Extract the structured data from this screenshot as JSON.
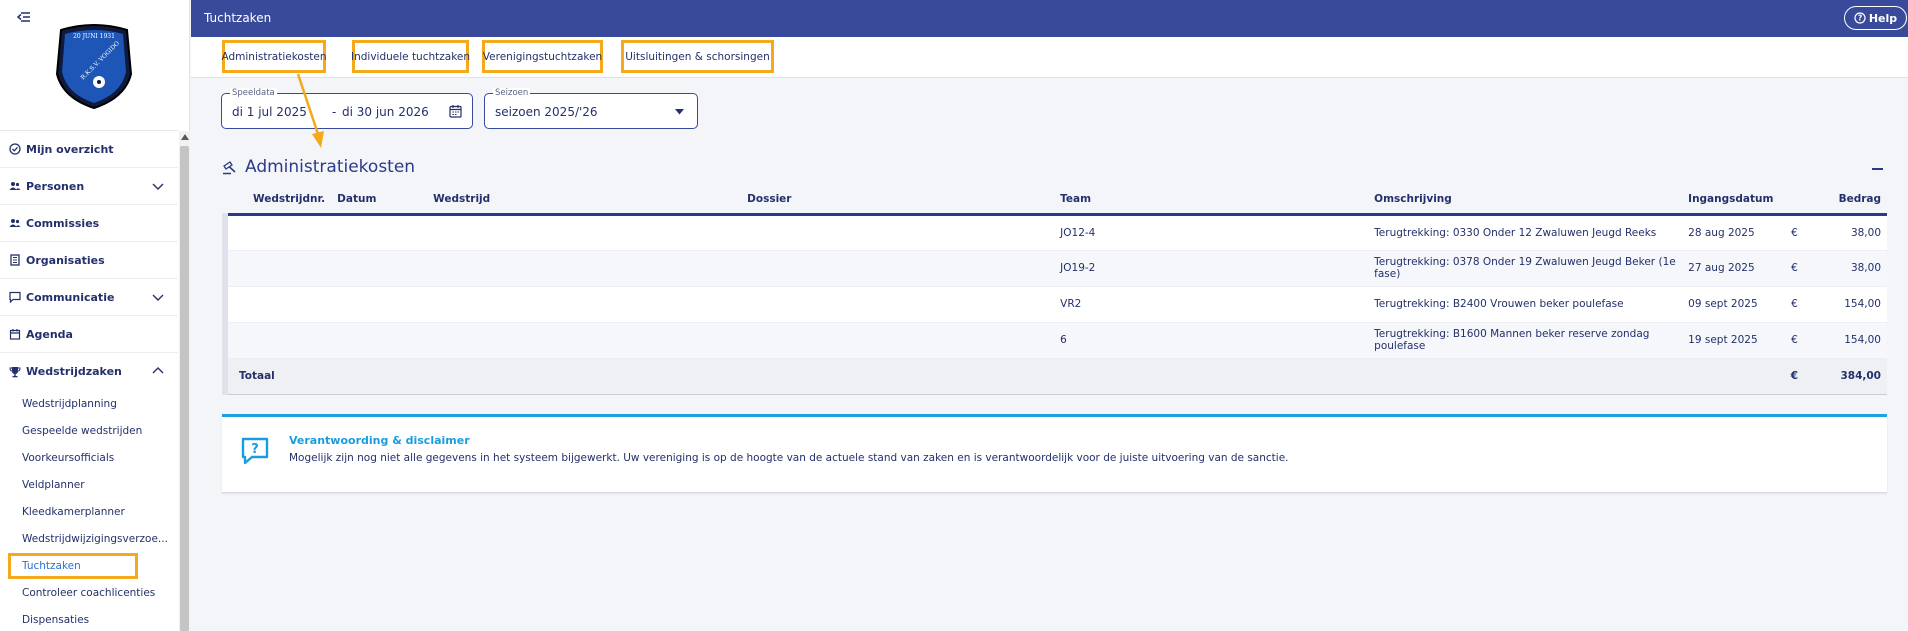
{
  "sidebar": {
    "logo_text": "R.K.S.V. VOGIDO 20 JUNI 1931",
    "items": [
      {
        "label": "Mijn overzicht",
        "icon": "check-circle-icon"
      },
      {
        "label": "Personen",
        "icon": "users-icon",
        "expandable": true
      },
      {
        "label": "Commissies",
        "icon": "users-icon"
      },
      {
        "label": "Organisaties",
        "icon": "building-icon"
      },
      {
        "label": "Communicatie",
        "icon": "chat-icon",
        "expandable": true
      },
      {
        "label": "Agenda",
        "icon": "calendar-icon"
      },
      {
        "label": "Wedstrijdzaken",
        "icon": "trophy-icon",
        "expanded": true
      }
    ],
    "subitems": [
      "Wedstrijdplanning",
      "Gespeelde wedstrijden",
      "Voorkeursofficials",
      "Veldplanner",
      "Kleedkamerplanner",
      "Wedstrijdwijzigingsverzoe...",
      "Tuchtzaken",
      "Controleer coachlicenties",
      "Dispensaties"
    ]
  },
  "header": {
    "title": "Tuchtzaken",
    "help_label": "Help"
  },
  "tabs": [
    {
      "label": "Administratiekosten",
      "active": true
    },
    {
      "label": "Individuele tuchtzaken"
    },
    {
      "label": "Verenigingstuchtzaken"
    },
    {
      "label": "Uitsluitingen & schorsingen"
    }
  ],
  "filters": {
    "date_legend": "Speeldata",
    "date_from": "di 1 jul 2025",
    "date_sep": "-",
    "date_to": "di 30 jun 2026",
    "season_legend": "Seizoen",
    "season_value": "seizoen 2025/'26"
  },
  "panel": {
    "title": "Administratiekosten",
    "columns": [
      "Wedstrijdnr.",
      "Datum",
      "Wedstrijd",
      "Dossier",
      "Team",
      "Omschrijving",
      "Ingangsdatum",
      "Bedrag"
    ],
    "rows": [
      {
        "team": "JO12-4",
        "omschrijving": "Terugtrekking: 0330 Onder 12 Zwaluwen Jeugd Reeks",
        "ingangsdatum": "28 aug 2025",
        "currency": "€",
        "bedrag": "38,00"
      },
      {
        "team": "JO19-2",
        "omschrijving": "Terugtrekking: 0378 Onder 19 Zwaluwen Jeugd Beker (1e fase)",
        "ingangsdatum": "27 aug 2025",
        "currency": "€",
        "bedrag": "38,00"
      },
      {
        "team": "VR2",
        "omschrijving": "Terugtrekking: B2400 Vrouwen beker poulefase",
        "ingangsdatum": "09 sept 2025",
        "currency": "€",
        "bedrag": "154,00"
      },
      {
        "team": "6",
        "omschrijving": "Terugtrekking: B1600 Mannen beker reserve zondag poulefase",
        "ingangsdatum": "19 sept 2025",
        "currency": "€",
        "bedrag": "154,00"
      }
    ],
    "total_label": "Totaal",
    "total_currency": "€",
    "total_value": "384,00"
  },
  "disclaimer": {
    "title": "Verantwoording & disclaimer",
    "text": "Mogelijk zijn nog niet alle gegevens in het systeem bijgewerkt. Uw vereniging is op de hoogte van de actuele stand van zaken en is verantwoordelijk voor de juiste uitvoering van de sanctie."
  },
  "colors": {
    "header_bg": "#3a4a9b",
    "highlight": "#f4a91d",
    "accent_blue": "#19a3e0"
  }
}
